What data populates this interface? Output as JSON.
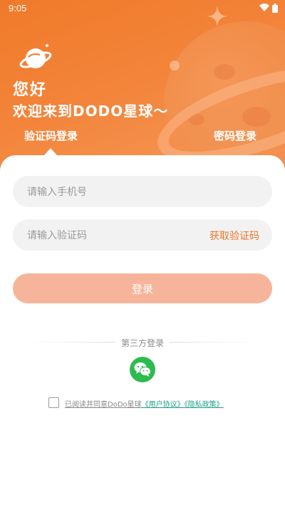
{
  "status_bar": {
    "time": "9:05",
    "icons": [
      "wifi-icon",
      "battery-icon"
    ]
  },
  "header": {
    "greeting": "您好",
    "welcome": "欢迎来到DODO星球～",
    "logo_icon": "planet-logo-icon"
  },
  "tabs": [
    {
      "label": "验证码登录",
      "active": true
    },
    {
      "label": "密码登录",
      "active": false
    }
  ],
  "form": {
    "phone": {
      "value": "",
      "placeholder": "请输入手机号"
    },
    "code": {
      "value": "",
      "placeholder": "请输入验证码"
    },
    "get_code_label": "获取验证码",
    "login_label": "登录"
  },
  "third_party": {
    "label": "第三方登录",
    "wechat_icon": "wechat-icon"
  },
  "agreement": {
    "checked": false,
    "text": "已阅读并同意DoDo星球",
    "user_agreement": "《用户协议》",
    "privacy_policy": "《隐私政策》"
  },
  "colors": {
    "brand_orange": "#f07a2a",
    "button_disabled": "#f6b59a",
    "link": "#1f9c8a",
    "wechat_green": "#2dbb4f",
    "input_bg": "#f3f2f2"
  }
}
